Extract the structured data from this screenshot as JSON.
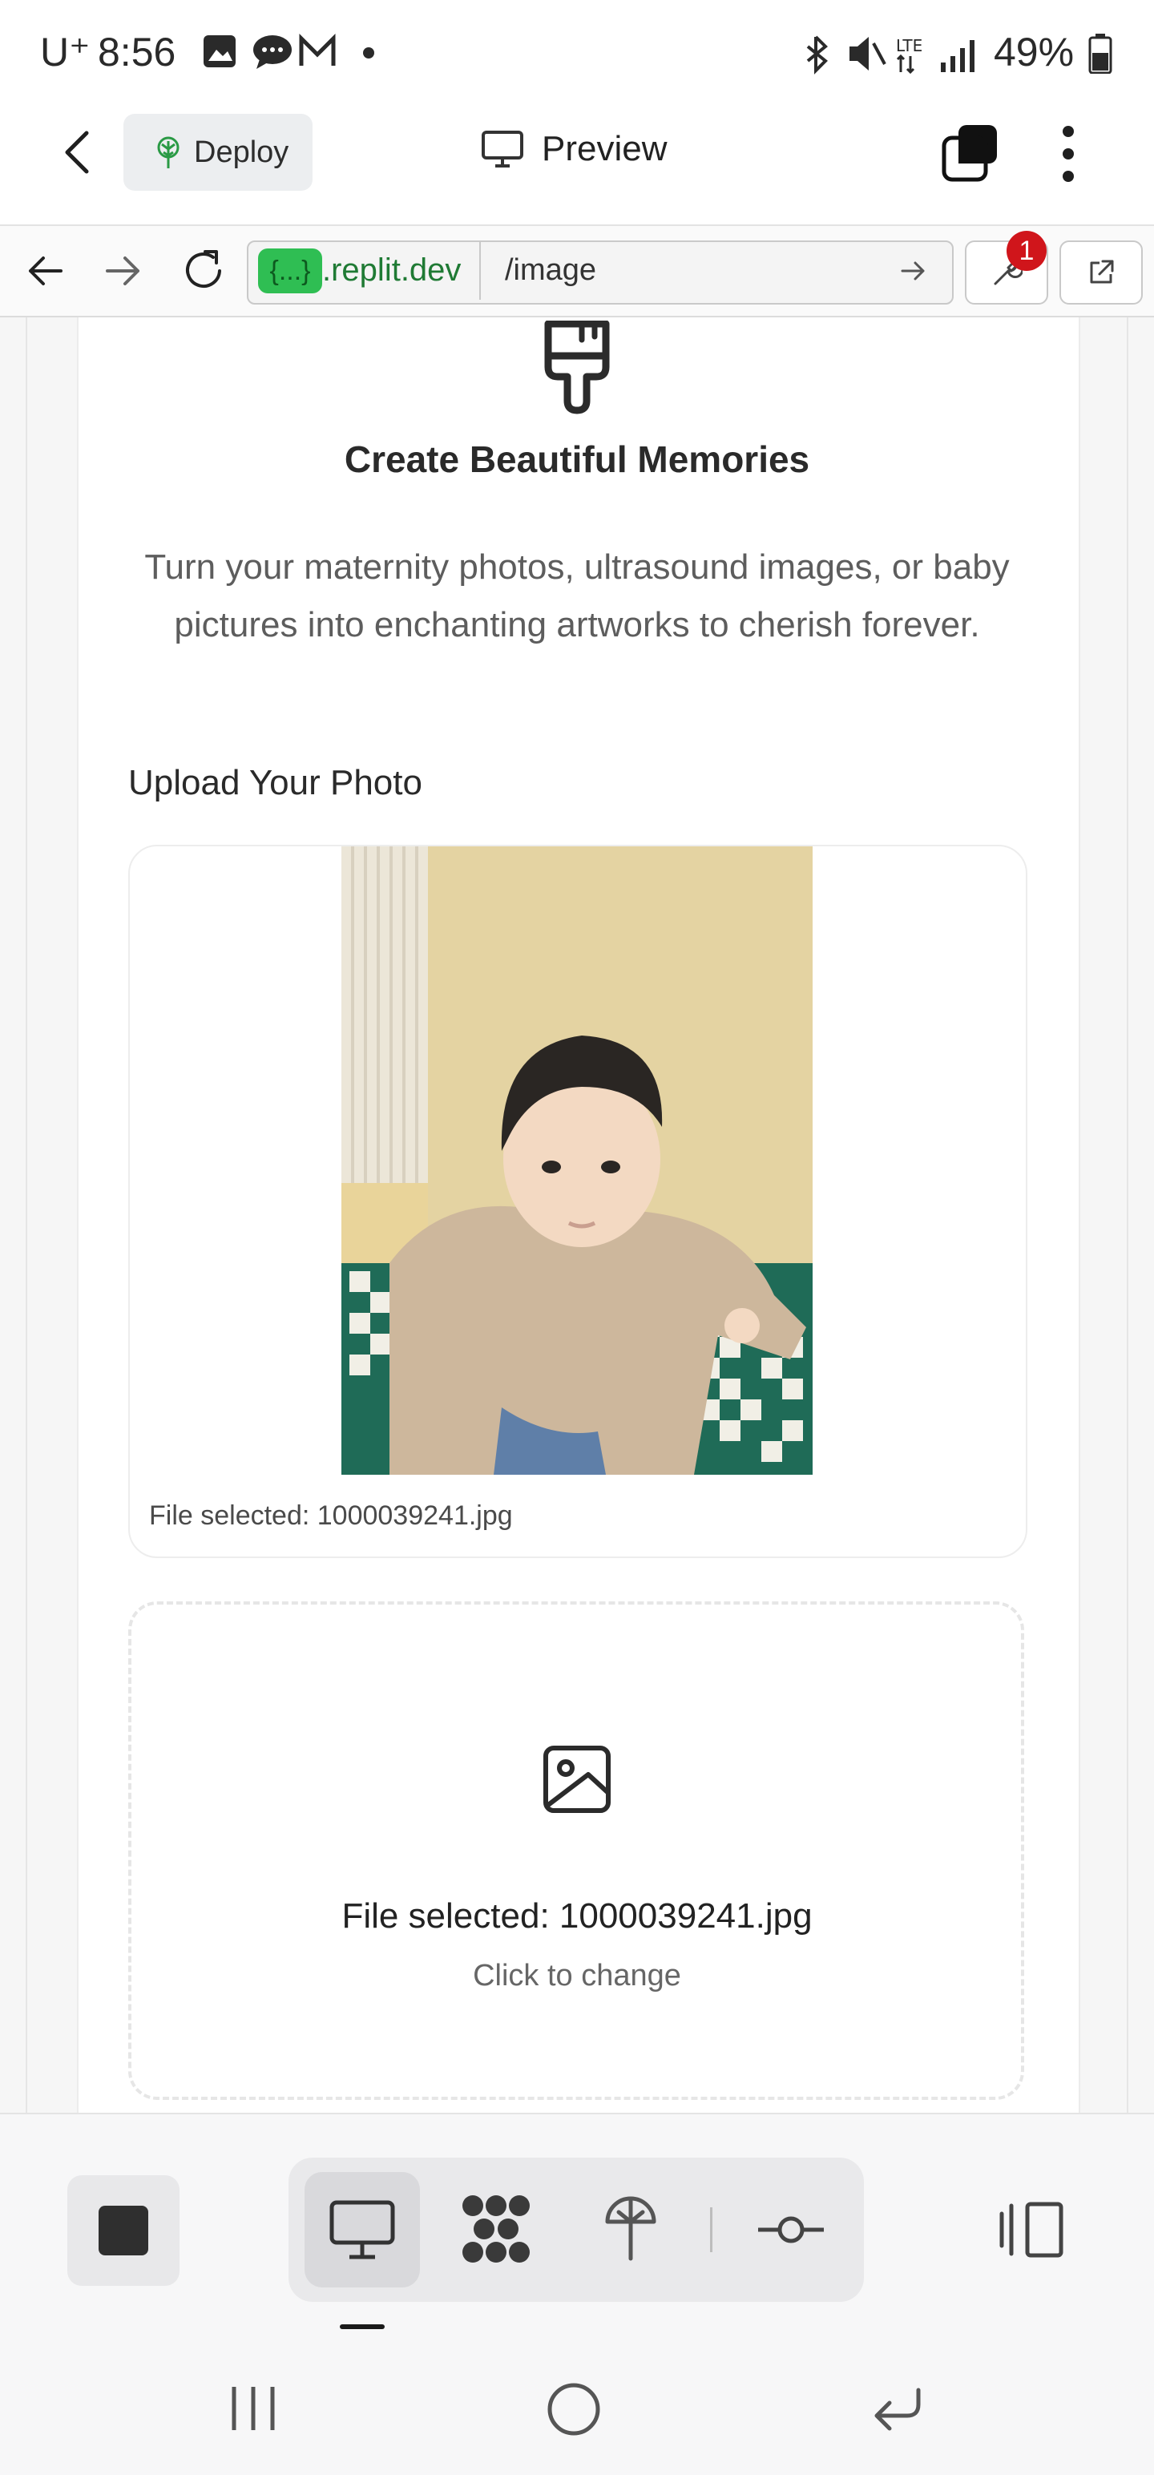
{
  "status_bar": {
    "carrier": "U⁺",
    "time": "8:56",
    "network": "LTE",
    "battery": "49%"
  },
  "app_header": {
    "deploy_label": "Deploy",
    "preview_label": "Preview"
  },
  "url_bar": {
    "domain_chip": "{...}",
    "domain_suffix": ".replit.dev",
    "path": "/image",
    "devtools_badge": "1"
  },
  "page": {
    "headline": "Create Beautiful Memories",
    "description": "Turn your maternity photos, ultrasound images, or baby pictures into enchanting artworks to cherish forever.",
    "upload_label": "Upload Your Photo",
    "preview_caption": "File selected: 1000039241.jpg",
    "dropzone_title": "File selected: 1000039241.jpg",
    "dropzone_hint": "Click to change"
  },
  "colors": {
    "accent_green": "#2fbe53",
    "badge_red": "#d0151b"
  },
  "icons": [
    "back-chevron-icon",
    "deploy-icon",
    "monitor-icon",
    "tabs-icon",
    "kebab-menu-icon",
    "arrow-left-icon",
    "arrow-right-icon",
    "reload-icon",
    "wrench-icon",
    "external-link-icon",
    "paintbrush-icon",
    "image-icon",
    "stop-icon",
    "desktop-icon",
    "workflow-icon",
    "deploy-icon",
    "commit-icon",
    "panel-icon"
  ]
}
